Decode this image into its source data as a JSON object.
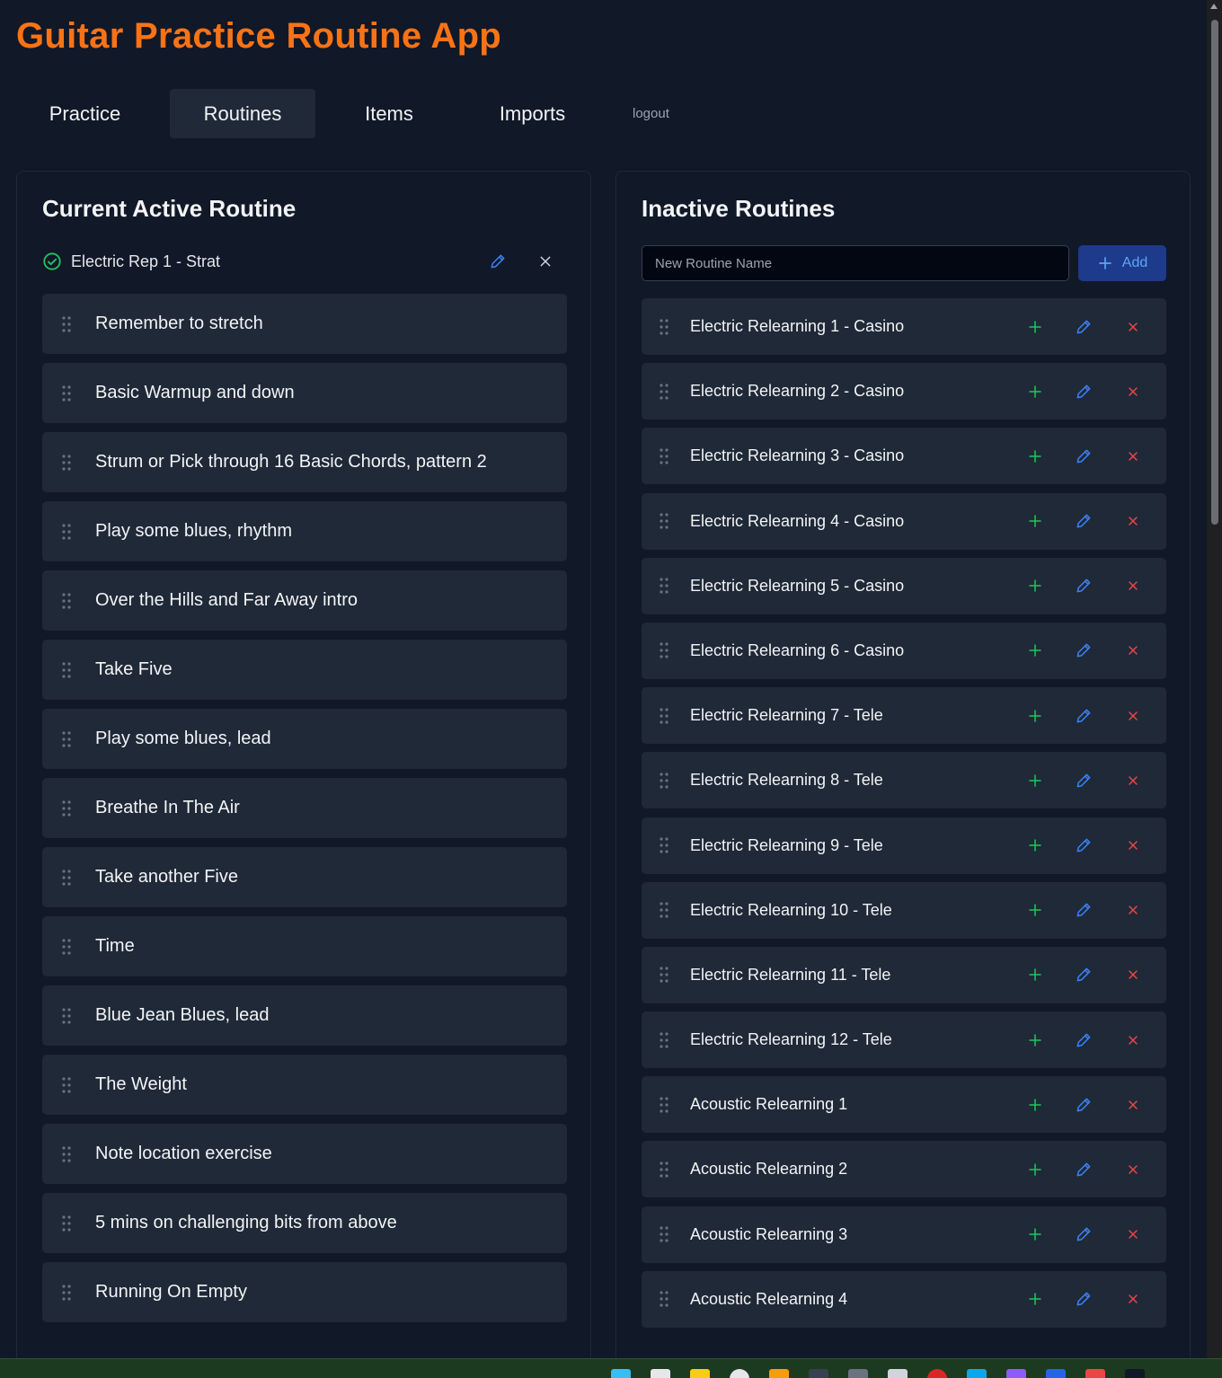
{
  "app": {
    "title": "Guitar Practice Routine App"
  },
  "nav": {
    "tabs": [
      {
        "label": "Practice",
        "active": false
      },
      {
        "label": "Routines",
        "active": true
      },
      {
        "label": "Items",
        "active": false
      },
      {
        "label": "Imports",
        "active": false
      }
    ],
    "logout_label": "logout"
  },
  "active_panel": {
    "title": "Current Active Routine",
    "routine_name": "Electric Rep 1 - Strat",
    "items": [
      "Remember to stretch",
      "Basic Warmup and down",
      "Strum or Pick through 16 Basic Chords, pattern 2",
      "Play some blues, rhythm",
      "Over the Hills and Far Away intro",
      "Take Five",
      "Play some blues, lead",
      "Breathe In The Air",
      "Take another Five",
      "Time",
      "Blue Jean Blues, lead",
      "The Weight",
      "Note location exercise",
      "5 mins on challenging bits from above",
      "Running On Empty"
    ]
  },
  "inactive_panel": {
    "title": "Inactive Routines",
    "new_routine_placeholder": "New Routine Name",
    "new_routine_value": "",
    "add_label": "Add",
    "routines": [
      "Electric Relearning 1 - Casino",
      "Electric Relearning 2 - Casino",
      "Electric Relearning 3 - Casino",
      "Electric Relearning 4 - Casino",
      "Electric Relearning 5 - Casino",
      "Electric Relearning 6 - Casino",
      "Electric Relearning 7 - Tele",
      "Electric Relearning 8 - Tele",
      "Electric Relearning 9 - Tele",
      "Electric Relearning 10 - Tele",
      "Electric Relearning 11 - Tele",
      "Electric Relearning 12 - Tele",
      "Acoustic Relearning 1",
      "Acoustic Relearning 2",
      "Acoustic Relearning 3",
      "Acoustic Relearning 4"
    ]
  },
  "colors": {
    "accent": "#f97316",
    "background": "#111827",
    "card": "#1f2937",
    "success": "#22c55e",
    "edit": "#3b82f6",
    "danger": "#ef4444"
  },
  "icons": {
    "active_status": "check-circle-icon",
    "drag": "drag-handle-icon",
    "activate": "plus-icon",
    "edit": "pencil-icon",
    "delete": "x-icon",
    "remove": "close-icon"
  }
}
